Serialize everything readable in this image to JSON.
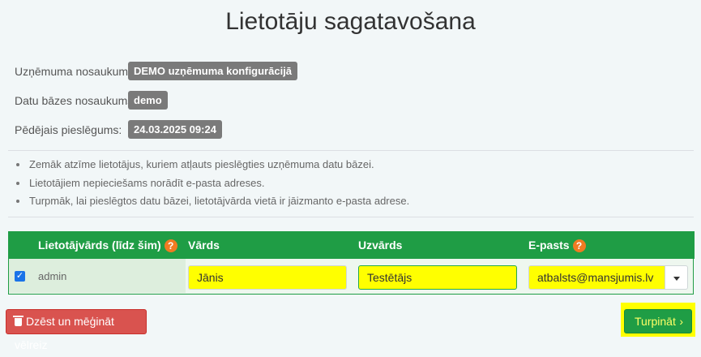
{
  "page": {
    "title": "Lietotāju sagatavošana"
  },
  "info": {
    "company_label": "Uzņēmuma nosaukums:",
    "company_value": "DEMO uzņēmuma konfigurācijā",
    "db_label": "Datu bāzes nosaukums:",
    "db_value": "demo",
    "last_login_label": "Pēdējais pieslēgums:",
    "last_login_value": "24.03.2025 09:24"
  },
  "notes": [
    "Zemāk atzīme lietotājus, kuriem atļauts pieslēgties uzņēmuma datu bāzei.",
    "Lietotājiem nepieciešams norādīt e-pasta adreses.",
    "Turpmāk, lai pieslēgtos datu bāzei, lietotājvārda vietā ir jāizmanto e-pasta adrese."
  ],
  "table": {
    "headers": {
      "username": "Lietotājvārds (līdz šim)",
      "first_name": "Vārds",
      "last_name": "Uzvārds",
      "email": "E-pasts"
    },
    "help_glyph": "?",
    "rows": [
      {
        "checked": true,
        "username": "admin",
        "first_name": "Jānis",
        "last_name": "Testētājs",
        "email": "atbalsts@mansjumis.lv"
      }
    ]
  },
  "buttons": {
    "delete_label": "Dzēst un mēģināt vēlreiz",
    "continue_label": "Turpināt",
    "continue_chevron": "›"
  },
  "colors": {
    "header_green": "#1f9d45",
    "highlight_yellow": "#ffff00",
    "danger_red": "#d9534f",
    "badge_gray": "#7a7a7a",
    "help_orange": "#f07b22"
  },
  "icons": {
    "checkbox": "checkbox-checked-icon",
    "help": "question-circle-icon",
    "delete": "trash-icon",
    "dropdown": "caret-down-icon",
    "continue": "chevron-right-icon"
  }
}
